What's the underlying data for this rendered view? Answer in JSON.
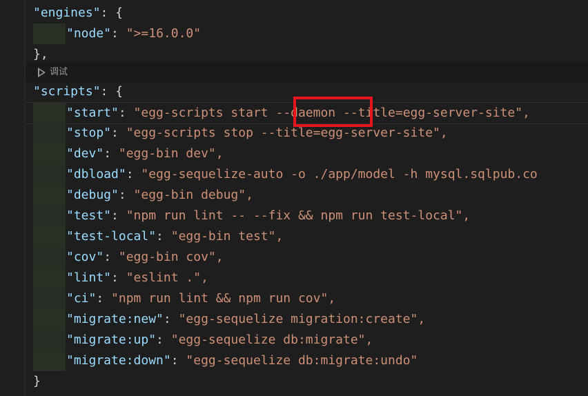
{
  "codelens": {
    "label": "调试",
    "icon": "play-icon"
  },
  "code": {
    "engines_key": "\"engines\"",
    "engines_open": ": {",
    "node_key": "\"node\"",
    "node_value": "\">=16.0.0\"",
    "engines_close": "},",
    "scripts_key": "\"scripts\"",
    "scripts_open": ": {",
    "scripts_close": "}",
    "scripts": [
      {
        "key": "\"start\"",
        "pre": "\"egg-scripts start ",
        "flag": "--daemon",
        "post": " --title=egg-server-site\","
      },
      {
        "key": "\"stop\"",
        "value": "\"egg-scripts stop --title=egg-server-site\","
      },
      {
        "key": "\"dev\"",
        "value": "\"egg-bin dev\","
      },
      {
        "key": "\"dbload\"",
        "value": "\"egg-sequelize-auto -o ./app/model -h mysql.sqlpub.co"
      },
      {
        "key": "\"debug\"",
        "value": "\"egg-bin debug\","
      },
      {
        "key": "\"test\"",
        "value": "\"npm run lint -- --fix && npm run test-local\","
      },
      {
        "key": "\"test-local\"",
        "value": "\"egg-bin test\","
      },
      {
        "key": "\"cov\"",
        "value": "\"egg-bin cov\","
      },
      {
        "key": "\"lint\"",
        "value": "\"eslint .\","
      },
      {
        "key": "\"ci\"",
        "value": "\"npm run lint && npm run cov\","
      },
      {
        "key": "\"migrate:new\"",
        "value": "\"egg-sequelize migration:create\","
      },
      {
        "key": "\"migrate:up\"",
        "value": "\"egg-sequelize db:migrate\","
      },
      {
        "key": "\"migrate:down\"",
        "value": "\"egg-sequelize db:migrate:undo\""
      }
    ]
  },
  "colors": {
    "background": "#1e1e1e",
    "key": "#9cdcfe",
    "string": "#ce9178",
    "highlight": "#e8141b"
  }
}
